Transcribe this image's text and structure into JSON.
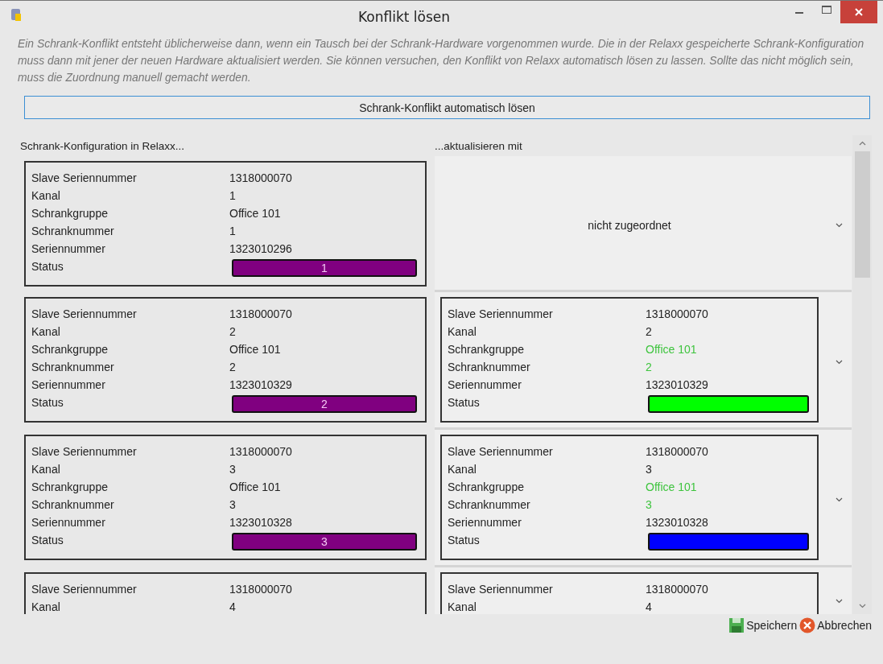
{
  "window": {
    "title": "Konflikt lösen"
  },
  "description": "Ein Schrank-Konflikt entsteht üblicherweise dann, wenn ein Tausch bei der Schrank-Hardware vorgenommen wurde. Die in der Relaxx gespeicherte Schrank-Konfiguration muss dann mit jener der neuen Hardware aktualisiert werden. Sie können versuchen, den Konflikt von Relaxx automatisch lösen zu lassen. Sollte das nicht möglich sein, muss die Zuordnung manuell gemacht werden.",
  "auto_button": "Schrank-Konflikt automatisch lösen",
  "left_header": "Schrank-Konfiguration in Relaxx...",
  "right_header": "...aktualisieren mit",
  "current": [
    {
      "rows": [
        {
          "label": "Slave Seriennummer",
          "value": "1318000070"
        },
        {
          "label": "Kanal",
          "value": "1"
        },
        {
          "label": "Schrankgruppe",
          "value": "Office 101"
        },
        {
          "label": "Schranknummer",
          "value": "1"
        },
        {
          "label": "Seriennummer",
          "value": "1323010296"
        }
      ],
      "status": {
        "label": "Status",
        "text": "1",
        "color": "#800080"
      }
    },
    {
      "rows": [
        {
          "label": "Slave Seriennummer",
          "value": "1318000070"
        },
        {
          "label": "Kanal",
          "value": "2"
        },
        {
          "label": "Schrankgruppe",
          "value": "Office 101"
        },
        {
          "label": "Schranknummer",
          "value": "2"
        },
        {
          "label": "Seriennummer",
          "value": "1323010329"
        }
      ],
      "status": {
        "label": "Status",
        "text": "2",
        "color": "#800080"
      }
    },
    {
      "rows": [
        {
          "label": "Slave Seriennummer",
          "value": "1318000070"
        },
        {
          "label": "Kanal",
          "value": "3"
        },
        {
          "label": "Schrankgruppe",
          "value": "Office 101"
        },
        {
          "label": "Schranknummer",
          "value": "3"
        },
        {
          "label": "Seriennummer",
          "value": "1323010328"
        }
      ],
      "status": {
        "label": "Status",
        "text": "3",
        "color": "#800080"
      }
    },
    {
      "rows": [
        {
          "label": "Slave Seriennummer",
          "value": "1318000070"
        },
        {
          "label": "Kanal",
          "value": "4"
        }
      ]
    }
  ],
  "updates": [
    {
      "kind": "unassigned",
      "text": "nicht zugeordnet"
    },
    {
      "kind": "card",
      "rows": [
        {
          "label": "Slave Seriennummer",
          "value": "1318000070",
          "highlight": false
        },
        {
          "label": "Kanal",
          "value": "2",
          "highlight": false
        },
        {
          "label": "Schrankgruppe",
          "value": "Office 101",
          "highlight": true
        },
        {
          "label": "Schranknummer",
          "value": "2",
          "highlight": true
        },
        {
          "label": "Seriennummer",
          "value": "1323010329",
          "highlight": false
        }
      ],
      "status": {
        "label": "Status",
        "color": "#00ff00"
      }
    },
    {
      "kind": "card",
      "rows": [
        {
          "label": "Slave Seriennummer",
          "value": "1318000070",
          "highlight": false
        },
        {
          "label": "Kanal",
          "value": "3",
          "highlight": false
        },
        {
          "label": "Schrankgruppe",
          "value": "Office 101",
          "highlight": true
        },
        {
          "label": "Schranknummer",
          "value": "3",
          "highlight": true
        },
        {
          "label": "Seriennummer",
          "value": "1323010328",
          "highlight": false
        }
      ],
      "status": {
        "label": "Status",
        "color": "#0000ff"
      }
    },
    {
      "kind": "card",
      "rows": [
        {
          "label": "Slave Seriennummer",
          "value": "1318000070",
          "highlight": false
        },
        {
          "label": "Kanal",
          "value": "4",
          "highlight": false
        }
      ]
    }
  ],
  "footer": {
    "save": "Speichern",
    "cancel": "Abbrechen"
  }
}
